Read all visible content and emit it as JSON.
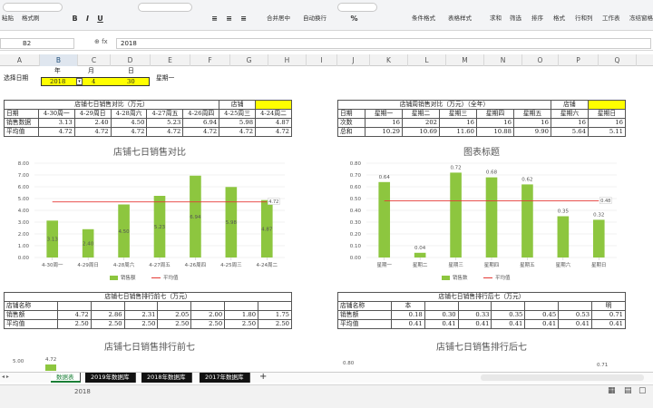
{
  "ribbon": {
    "paste_label": "粘贴",
    "format_painter_label": "格式刷",
    "bold": "B",
    "italic": "I",
    "underline": "U",
    "percent": "%",
    "merge_label": "合并居中",
    "wrap_label": "自动换行",
    "cond_format_label": "条件格式",
    "table_style_label": "表格样式",
    "sum_label": "求和",
    "filter_label": "筛选",
    "sort_label": "排序",
    "format_label": "格式",
    "rowcol_label": "行和列",
    "sheet_label": "工作表",
    "freeze_label": "冻结窗格"
  },
  "formula_bar": {
    "name_box": "B2",
    "fx": "fx",
    "value": "2018"
  },
  "columns": [
    "A",
    "B",
    "C",
    "D",
    "E",
    "F",
    "G",
    "H",
    "I",
    "J",
    "K",
    "L",
    "M",
    "N",
    "O",
    "P",
    "Q"
  ],
  "selector": {
    "label": "选择日期",
    "year_h": "年",
    "month_h": "月",
    "day_h": "日",
    "year": "2018",
    "month": "4",
    "day": "30",
    "weekday": "星期一"
  },
  "left_table": {
    "title": "店铺七日销售对比（万元）",
    "store_label": "店铺",
    "rows": [
      [
        "日期",
        "4-30周一",
        "4-29周日",
        "4-28周六",
        "4-27周五",
        "4-26周四",
        "4-25周三",
        "4-24周二"
      ],
      [
        "销售数据",
        "3.13",
        "2.40",
        "4.50",
        "5.23",
        "6.94",
        "5.98",
        "4.87"
      ],
      [
        "平均值",
        "4.72",
        "4.72",
        "4.72",
        "4.72",
        "4.72",
        "4.72",
        "4.72"
      ]
    ]
  },
  "right_table": {
    "title": "店铺周销售对比（万元）（全年）",
    "store_label": "店铺",
    "rows": [
      [
        "日期",
        "星期一",
        "星期二",
        "星期三",
        "星期四",
        "星期五",
        "星期六",
        "星期日"
      ],
      [
        "次数",
        "16",
        "202",
        "16",
        "16",
        "16",
        "16",
        "16"
      ],
      [
        "总和",
        "10.29",
        "10.69",
        "11.60",
        "10.88",
        "9.90",
        "5.64",
        "5.11"
      ]
    ]
  },
  "chart1": {
    "title": "店铺七日销售对比",
    "series_bar": "销售额",
    "series_line": "平均值",
    "avg_label": "4.72",
    "yticks": [
      "8.00",
      "7.00",
      "6.00",
      "5.00",
      "4.00",
      "3.00",
      "2.00",
      "1.00",
      "0.00"
    ]
  },
  "chart2": {
    "title": "图表标题",
    "series_bar": "销售数",
    "series_line": "平均值",
    "avg_label": "0.48",
    "yticks": [
      "0.80",
      "0.70",
      "0.60",
      "0.50",
      "0.40",
      "0.30",
      "0.20",
      "0.10",
      "0.00"
    ]
  },
  "left_table2": {
    "title": "店铺七日销售排行前七（万元）",
    "rows": [
      [
        "店铺名称",
        "",
        "",
        "",
        "",
        "",
        "",
        ""
      ],
      [
        "销售额",
        "4.72",
        "2.86",
        "2.31",
        "2.05",
        "2.00",
        "1.80",
        "1.75"
      ],
      [
        "平均值",
        "2.50",
        "2.50",
        "2.50",
        "2.50",
        "2.50",
        "2.50",
        "2.50"
      ]
    ]
  },
  "right_table2": {
    "title": "店铺七日销售排行后七（万元）",
    "rows": [
      [
        "店铺名称",
        "本",
        "",
        "",
        "",
        "",
        "",
        "明"
      ],
      [
        "销售额",
        "0.18",
        "0.30",
        "0.33",
        "0.35",
        "0.45",
        "0.53",
        "0.71"
      ],
      [
        "平均值",
        "0.41",
        "0.41",
        "0.41",
        "0.41",
        "0.41",
        "0.41",
        "0.41"
      ]
    ]
  },
  "chart3": {
    "title": "店铺七日销售排行前七",
    "ytick_top": "5.00",
    "first_label": "4.72"
  },
  "chart4": {
    "title": "店铺七日销售排行后七",
    "ytick_top": "0.80",
    "first_label": "0.71"
  },
  "sheet_tabs": [
    "数据表",
    "2019年数据库",
    "2018年数据库",
    "2017年数据库"
  ],
  "add_sheet": "+",
  "status_text": "2018",
  "chart_data": [
    {
      "type": "bar",
      "title": "店铺七日销售对比",
      "categories": [
        "4-30周一",
        "4-29周日",
        "4-28周六",
        "4-27周五",
        "4-26周四",
        "4-25周三",
        "4-24周二"
      ],
      "series": [
        {
          "name": "销售额",
          "values": [
            3.13,
            2.4,
            4.5,
            5.23,
            6.94,
            5.98,
            4.87
          ]
        },
        {
          "name": "平均值",
          "type": "line",
          "values": [
            4.72,
            4.72,
            4.72,
            4.72,
            4.72,
            4.72,
            4.72
          ]
        }
      ],
      "ylim": [
        0,
        8
      ],
      "grid": true,
      "legend": "bottom"
    },
    {
      "type": "bar",
      "title": "图表标题",
      "categories": [
        "星期一",
        "星期二",
        "星期三",
        "星期四",
        "星期五",
        "星期六",
        "星期日"
      ],
      "series": [
        {
          "name": "销售数",
          "values": [
            0.64,
            0.04,
            0.72,
            0.68,
            0.62,
            0.35,
            0.32
          ]
        },
        {
          "name": "平均值",
          "type": "line",
          "values": [
            0.48,
            0.48,
            0.48,
            0.48,
            0.48,
            0.48,
            0.48
          ]
        }
      ],
      "ylim": [
        0,
        0.8
      ],
      "grid": true,
      "legend": "bottom"
    }
  ],
  "colors": {
    "bar": "#8dc63f",
    "avg_line": "#e53935",
    "header_yellow": "#ffff00",
    "accent_green": "#1a7f37"
  }
}
